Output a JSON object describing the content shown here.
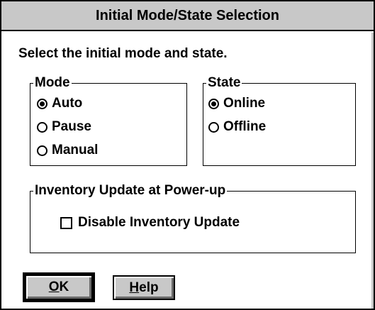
{
  "dialog": {
    "title": "Initial Mode/State Selection",
    "instruction": "Select the initial mode and state."
  },
  "mode_group": {
    "label": "Mode",
    "options": [
      {
        "label": "Auto",
        "selected": true
      },
      {
        "label": "Pause",
        "selected": false
      },
      {
        "label": "Manual",
        "selected": false
      }
    ]
  },
  "state_group": {
    "label": "State",
    "options": [
      {
        "label": "Online",
        "selected": true
      },
      {
        "label": "Offline",
        "selected": false
      }
    ]
  },
  "inventory_group": {
    "label": "Inventory Update at Power-up",
    "checkbox_label": "Disable Inventory Update",
    "checked": false
  },
  "buttons": {
    "ok": {
      "mnemonic": "O",
      "rest": "K"
    },
    "help": {
      "mnemonic": "H",
      "rest": "elp"
    }
  },
  "colors": {
    "titlebar": "#c8c8c8",
    "button_face": "#c8c8c8",
    "background": "#ffffff",
    "text": "#000000"
  }
}
